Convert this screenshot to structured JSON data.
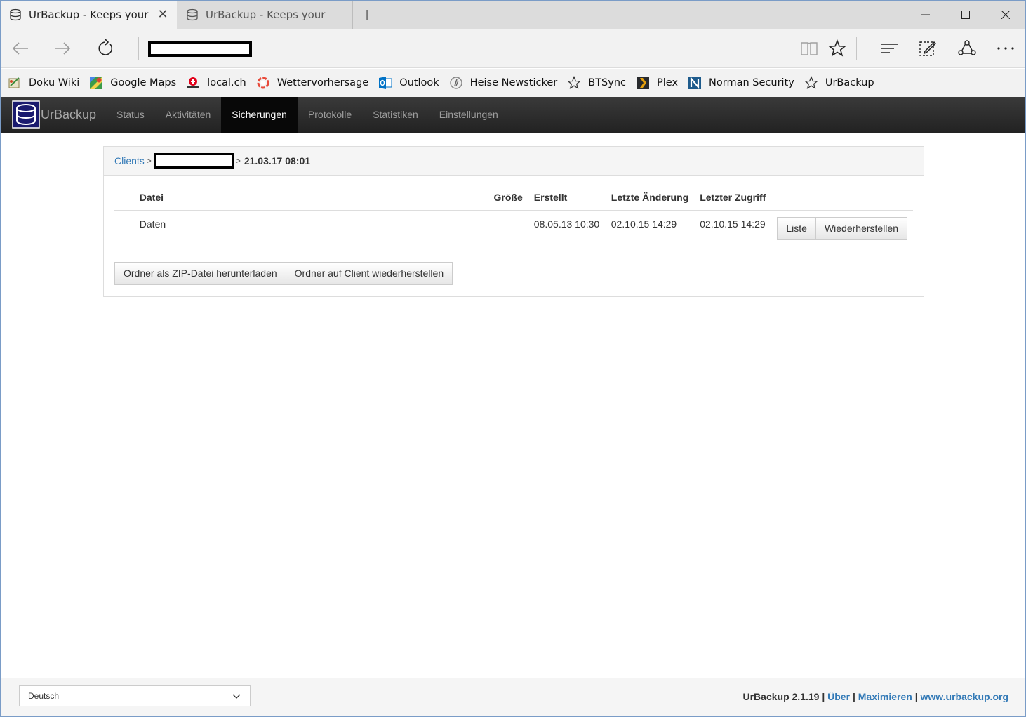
{
  "browser": {
    "tabs": [
      {
        "title": "UrBackup - Keeps your data",
        "active": true
      },
      {
        "title": "UrBackup - Keeps your data",
        "active": false
      }
    ],
    "tab_close_glyph": "✕",
    "new_tab_glyph": "+",
    "favorites": [
      {
        "label": "Doku Wiki",
        "icon": "wiki-icon"
      },
      {
        "label": "Google Maps",
        "icon": "maps-icon"
      },
      {
        "label": "local.ch",
        "icon": "localch-icon"
      },
      {
        "label": "Wettervorhersage",
        "icon": "weather-icon"
      },
      {
        "label": "Outlook",
        "icon": "outlook-icon"
      },
      {
        "label": "Heise Newsticker",
        "icon": "heise-icon"
      },
      {
        "label": "BTSync",
        "icon": "star-icon"
      },
      {
        "label": "Plex",
        "icon": "plex-icon"
      },
      {
        "label": "Norman Security",
        "icon": "norman-icon"
      },
      {
        "label": "UrBackup",
        "icon": "star-icon"
      }
    ]
  },
  "app": {
    "brand": "UrBackup",
    "nav": [
      "Status",
      "Aktivitäten",
      "Sicherungen",
      "Protokolle",
      "Statistiken",
      "Einstellungen"
    ],
    "active_nav": "Sicherungen"
  },
  "breadcrumb": {
    "clients": "Clients",
    "sep": ">",
    "current": "21.03.17 08:01"
  },
  "table": {
    "headers": {
      "file": "Datei",
      "size": "Größe",
      "created": "Erstellt",
      "modified": "Letzte Änderung",
      "accessed": "Letzter Zugriff"
    },
    "rows": [
      {
        "file": "Daten",
        "size": "",
        "created": "08.05.13 10:30",
        "modified": "02.10.15 14:29",
        "accessed": "02.10.15 14:29",
        "list_label": "Liste",
        "restore_label": "Wiederherstellen"
      }
    ]
  },
  "actions": {
    "zip": "Ordner als ZIP-Datei herunterladen",
    "restore_client": "Ordner auf Client wiederherstellen"
  },
  "footer": {
    "language": "Deutsch",
    "version": "UrBackup 2.1.19",
    "sep": "|",
    "about": "Über",
    "maximize": "Maximieren",
    "website": "www.urbackup.org"
  },
  "colors": {
    "link": "#337ab7",
    "navbar": "#222222",
    "nav_active": "#080808"
  }
}
